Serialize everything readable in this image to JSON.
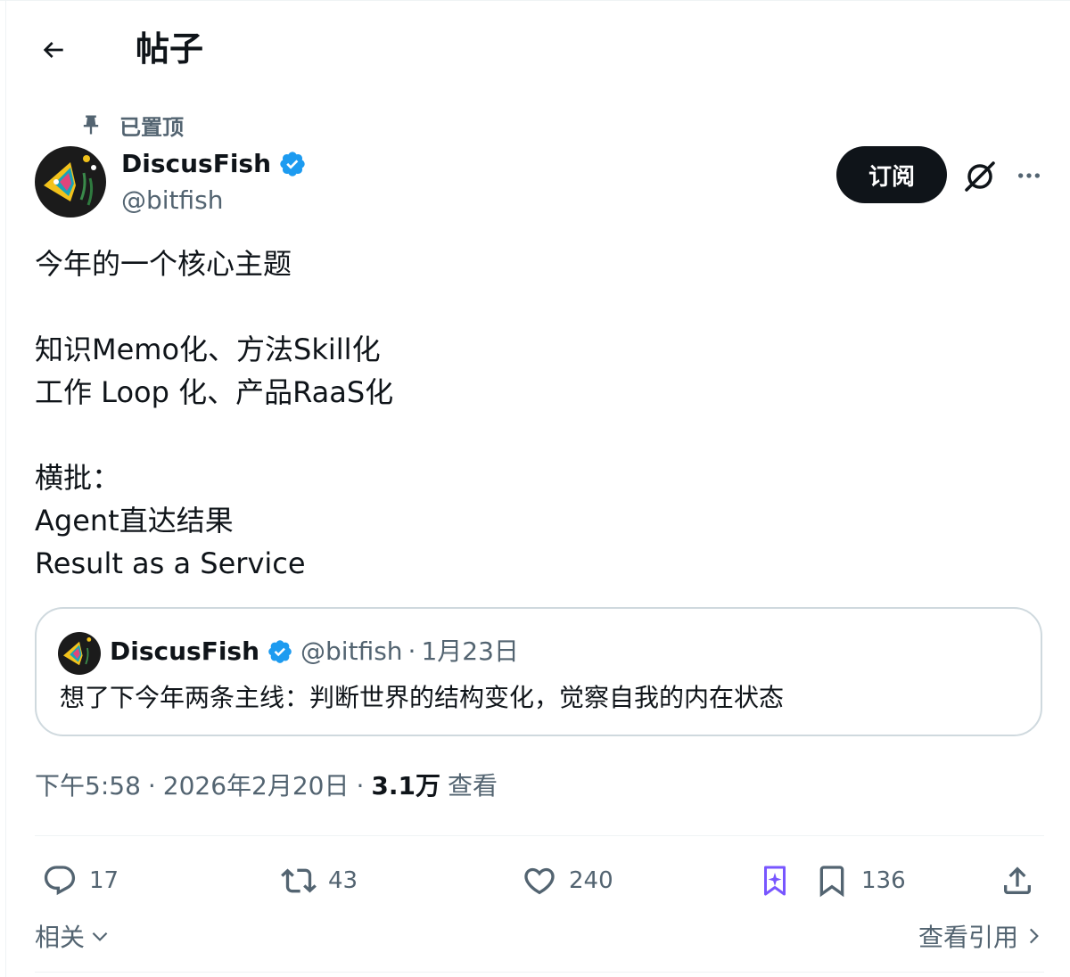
{
  "header": {
    "title": "帖子"
  },
  "tweet": {
    "pinned_label": "已置顶",
    "author": {
      "name": "DiscusFish",
      "handle": "@bitfish"
    },
    "subscribe_label": "订阅",
    "text": "今年的一个核心主题\n\n知识Memo化、方法Skill化\n工作 Loop  化、产品RaaS化\n\n横批：\nAgent直达结果\nResult as a Service",
    "quote": {
      "name": "DiscusFish",
      "handle": "@bitfish",
      "separator": "·",
      "date": "1月23日",
      "text": "想了下今年两条主线：判断世界的结构变化，觉察自我的内在状态"
    },
    "time": "下午5:58",
    "separator": "·",
    "date": "2026年2月20日",
    "views_count": "3.1万",
    "views_label": "查看"
  },
  "actions": {
    "replies": "17",
    "reposts": "43",
    "likes": "240",
    "bookmarks": "136"
  },
  "footer": {
    "related_label": "相关",
    "view_quotes_label": "查看引用"
  },
  "colors": {
    "text_primary": "#0f1419",
    "text_secondary": "#536471",
    "border": "#cfd9de",
    "verified": "#1d9bf0",
    "grok_purple": "#7856ff",
    "button_bg": "#0f1419"
  }
}
